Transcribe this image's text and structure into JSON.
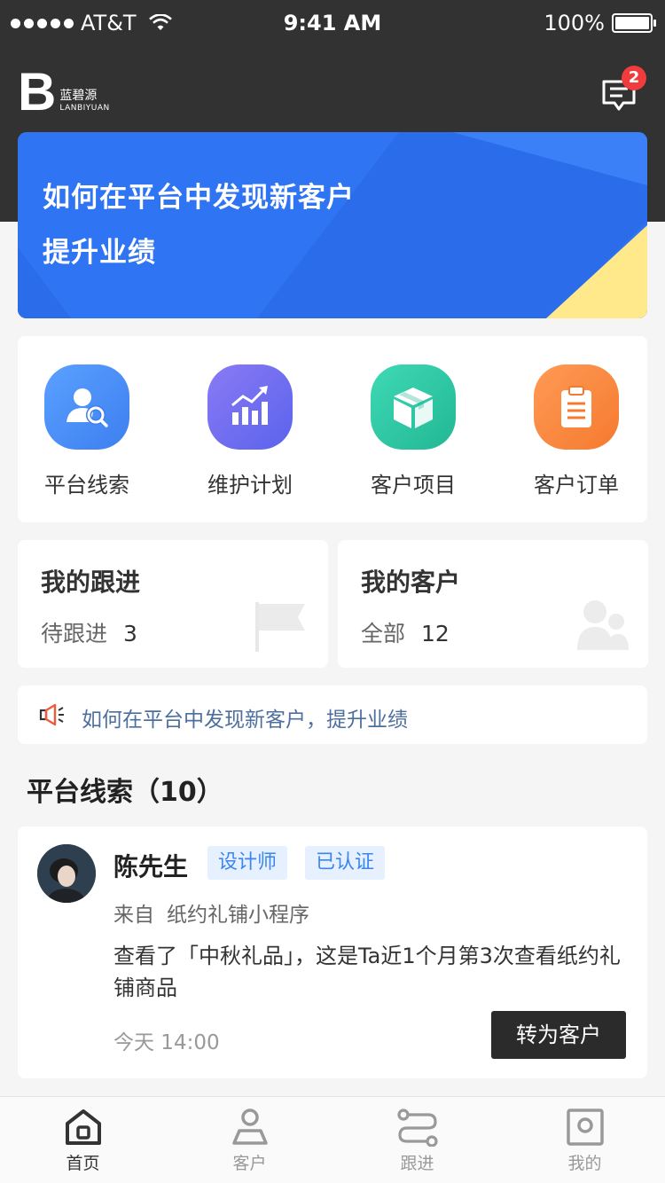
{
  "status_bar": {
    "carrier": "AT&T",
    "time": "9:41 AM",
    "battery": "100%"
  },
  "header": {
    "logo_letter": "B",
    "logo_cn": "蓝碧源",
    "logo_en": "LANBIYUAN",
    "message_badge": "2"
  },
  "banner": {
    "line1": "如何在平台中发现新客户",
    "line2": "提升业绩"
  },
  "quick_menu": [
    {
      "label": "平台线索",
      "icon": "user-search-icon",
      "color": "#4d8ff0"
    },
    {
      "label": "维护计划",
      "icon": "chart-up-icon",
      "color": "#6a6cf0"
    },
    {
      "label": "客户项目",
      "icon": "box-icon",
      "color": "#2fc8a6"
    },
    {
      "label": "客户订单",
      "icon": "clipboard-icon",
      "color": "#f98a43"
    }
  ],
  "follow_card": {
    "title": "我的跟进",
    "sub_label": "待跟进",
    "count": "3"
  },
  "customer_card": {
    "title": "我的客户",
    "sub_label": "全部",
    "count": "12"
  },
  "notice": {
    "text": "如何在平台中发现新客户，提升业绩"
  },
  "leads": {
    "section_title": "平台线索（10）",
    "items": [
      {
        "name": "陈先生",
        "tags": [
          "设计师",
          "已认证"
        ],
        "source_prefix": "来自",
        "source": "纸约礼铺小程序",
        "description": "查看了「中秋礼品」，这是Ta近1个月第3次查看纸约礼铺商品",
        "time": "今天 14:00",
        "action": "转为客户"
      }
    ]
  },
  "tab_bar": [
    {
      "label": "首页",
      "icon": "home-icon",
      "active": true
    },
    {
      "label": "客户",
      "icon": "customer-icon",
      "active": false
    },
    {
      "label": "跟进",
      "icon": "follow-path-icon",
      "active": false
    },
    {
      "label": "我的",
      "icon": "profile-icon",
      "active": false
    }
  ],
  "colors": {
    "header_bg": "#323232",
    "banner_blue": "#2f74f3",
    "banner_yellow": "#ffe98a",
    "notice_text": "#4d6f9e",
    "tag_text": "#3a86f0",
    "badge_red": "#f03c3c"
  }
}
